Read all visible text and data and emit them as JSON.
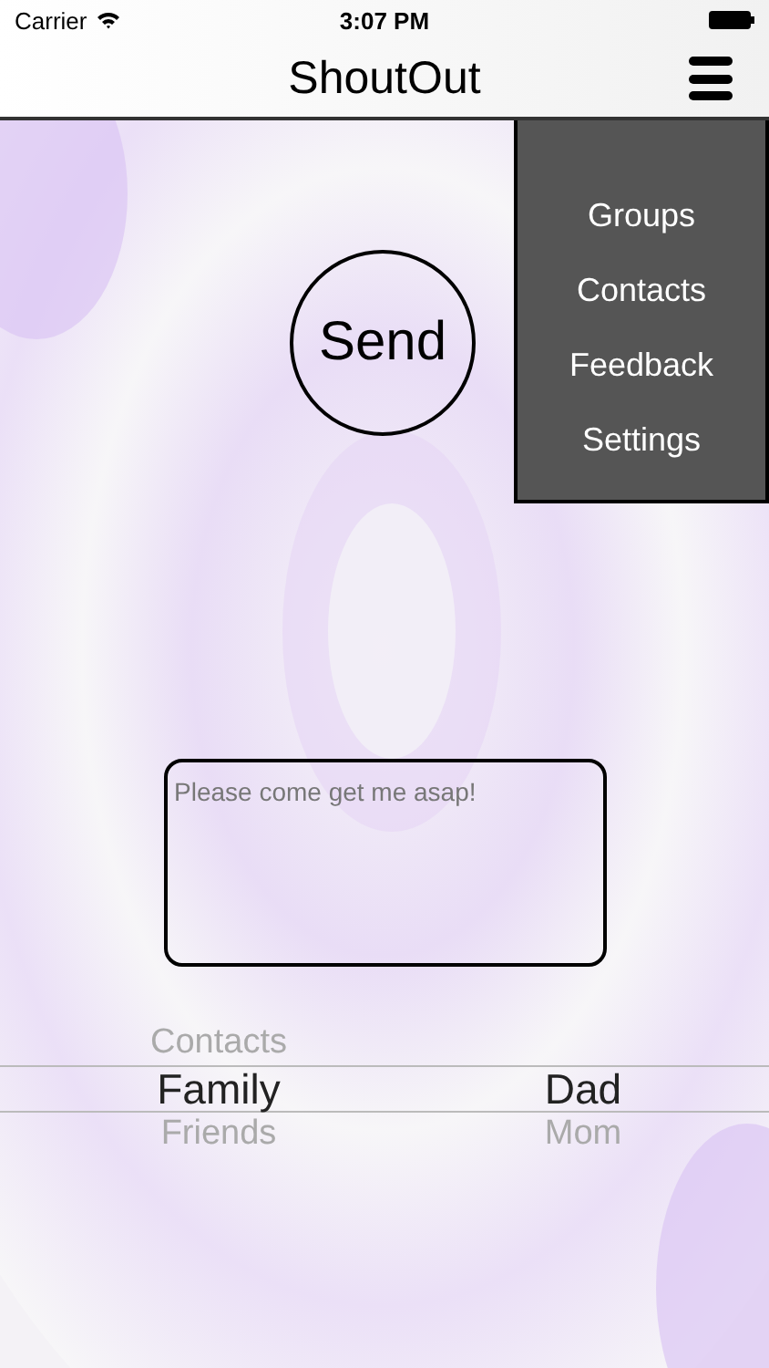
{
  "status_bar": {
    "carrier": "Carrier",
    "time": "3:07 PM"
  },
  "nav": {
    "title": "ShoutOut"
  },
  "menu": {
    "items": [
      "Groups",
      "Contacts",
      "Feedback",
      "Settings"
    ]
  },
  "send_button": {
    "label": "Send"
  },
  "message": {
    "placeholder": "Please come get me asap!"
  },
  "picker": {
    "columns": [
      {
        "items": [
          {
            "label": "Contacts",
            "selected": false
          },
          {
            "label": "Family",
            "selected": true
          },
          {
            "label": "Friends",
            "selected": false
          }
        ]
      },
      {
        "items": [
          {
            "label": "Dad",
            "selected": true
          },
          {
            "label": "Mom",
            "selected": false
          }
        ]
      }
    ]
  }
}
